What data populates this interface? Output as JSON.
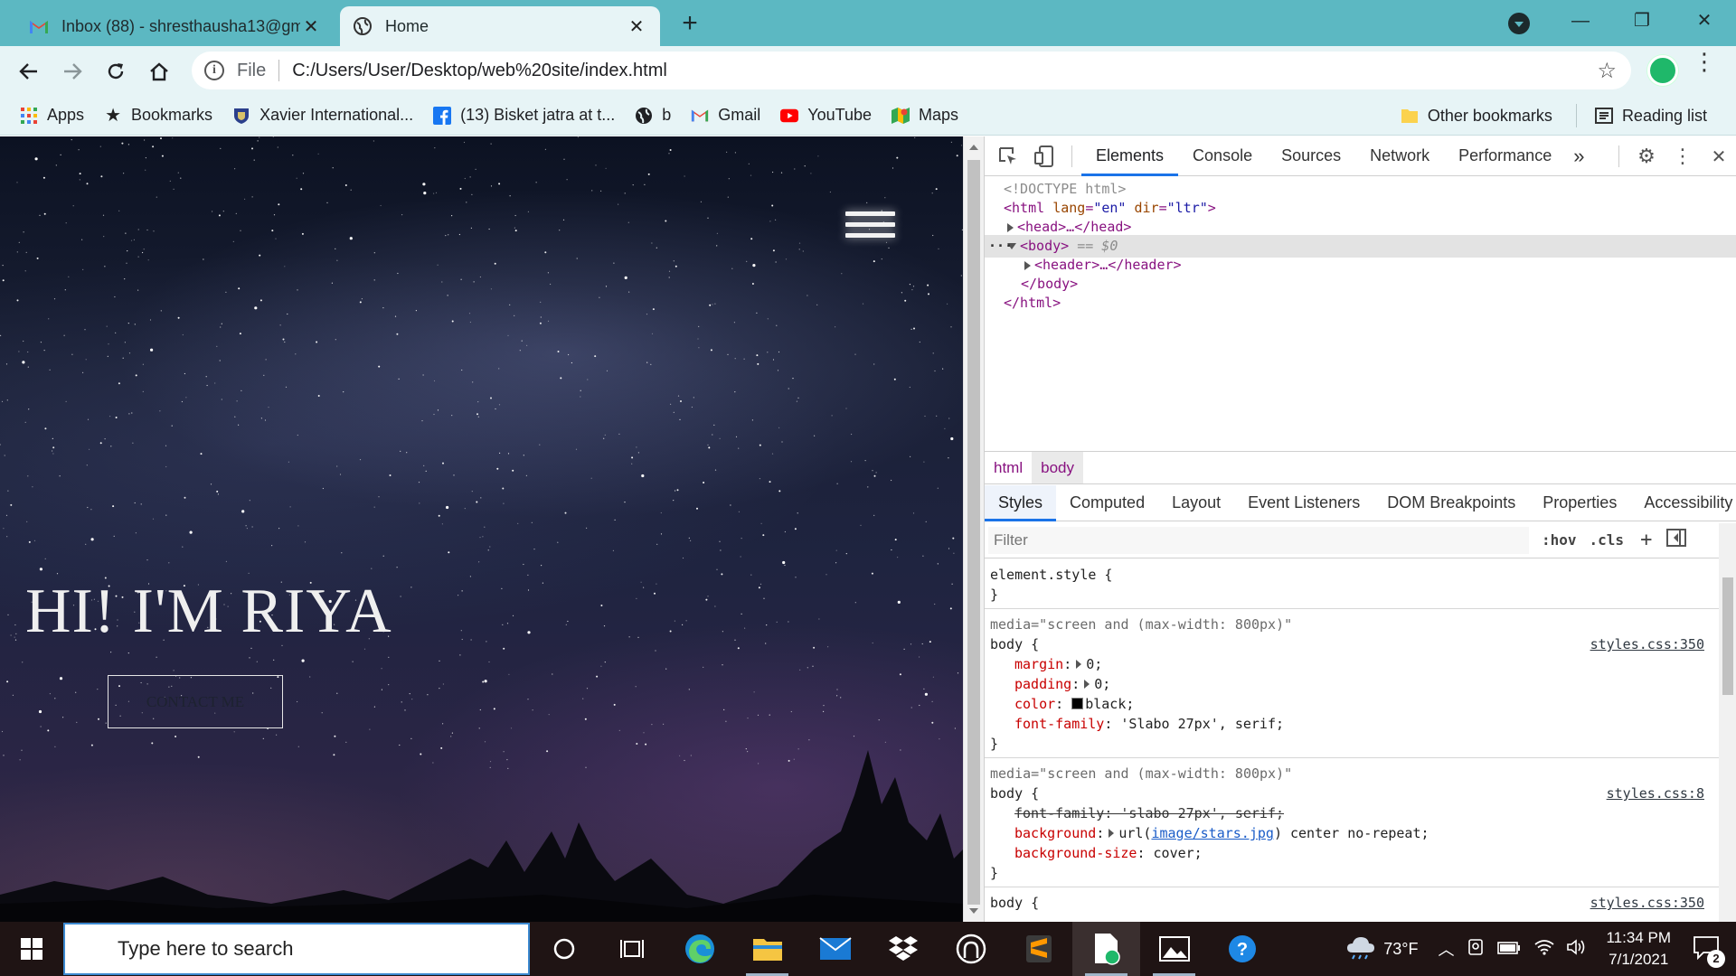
{
  "browser": {
    "tabs": [
      {
        "title": "Inbox (88) - shresthausha13@gm",
        "icon": "gmail-icon",
        "active": false
      },
      {
        "title": "Home",
        "icon": "globe-icon",
        "active": true
      }
    ],
    "address": {
      "scheme": "File",
      "url": "C:/Users/User/Desktop/web%20site/index.html"
    },
    "bookmarks": [
      {
        "label": "Apps",
        "icon": "apps-grid-icon"
      },
      {
        "label": "Bookmarks",
        "icon": "star-icon"
      },
      {
        "label": "Xavier International...",
        "icon": "shield-crest-icon"
      },
      {
        "label": "(13) Bisket jatra at t...",
        "icon": "facebook-icon"
      },
      {
        "label": "b",
        "icon": "globe-icon"
      },
      {
        "label": "Gmail",
        "icon": "gmail-icon"
      },
      {
        "label": "YouTube",
        "icon": "youtube-icon"
      },
      {
        "label": "Maps",
        "icon": "maps-icon"
      }
    ],
    "other_bookmarks": "Other bookmarks",
    "reading_list": "Reading list"
  },
  "page": {
    "hero_title": "HI! I'M RIYA",
    "contact_button": "CONTACT ME"
  },
  "devtools": {
    "tabs": [
      "Elements",
      "Console",
      "Sources",
      "Network",
      "Performance"
    ],
    "active_tab": "Elements",
    "more_tabs": "»",
    "dom": {
      "doctype": "<!DOCTYPE html>",
      "html_open_tag": "<html",
      "html_attr1_name": "lang",
      "html_attr1_value": "\"en\"",
      "html_attr2_name": "dir",
      "html_attr2_value": "\"ltr\"",
      "html_open_close": ">",
      "head": "<head>…</head>",
      "body_open": "<body>",
      "body_marker": "== $0",
      "header": "<header>…</header>",
      "body_close": "</body>",
      "html_close": "</html>",
      "dots": "···"
    },
    "breadcrumbs": [
      "html",
      "body"
    ],
    "subtabs": [
      "Styles",
      "Computed",
      "Layout",
      "Event Listeners",
      "DOM Breakpoints",
      "Properties",
      "Accessibility"
    ],
    "filter_placeholder": "Filter",
    "hov": ":hov",
    "cls": ".cls",
    "rules": {
      "element_style": "element.style {",
      "close_brace": "}",
      "rule1_media": "media=\"screen and (max-width: 800px)\"",
      "rule1_selector": "body {",
      "rule1_source": "styles.css:350",
      "rule1_margin_name": "margin",
      "rule1_margin_value": "0;",
      "rule1_padding_name": "padding",
      "rule1_padding_value": "0;",
      "rule1_color_name": "color",
      "rule1_color_value": "black;",
      "rule1_font_name": "font-family",
      "rule1_font_value": "'Slabo 27px', serif;",
      "rule2_media": "media=\"screen and (max-width: 800px)\"",
      "rule2_selector": "body {",
      "rule2_source": "styles.css:8",
      "rule2_font_struck": "font-family: 'slabo 27px', serif;",
      "rule2_bg_name": "background",
      "rule2_bg_pre": "url(",
      "rule2_bg_link": "image/stars.jpg",
      "rule2_bg_post": ") center no-repeat;",
      "rule2_size_name": "background-size",
      "rule2_size_value": "cover;",
      "rule3_selector": "body {",
      "rule3_source": "styles.css:350"
    }
  },
  "taskbar": {
    "search_placeholder": "Type here to search",
    "weather": "73°F",
    "time": "11:34 PM",
    "date": "7/1/2021",
    "notification_count": "2"
  },
  "colors": {
    "chrome_frame": "#5cb8c2",
    "chrome_toolbar": "#e7f4f6",
    "devtools_accent": "#1a73e8",
    "tag_color": "#881280",
    "taskbar": "#1f1414"
  }
}
